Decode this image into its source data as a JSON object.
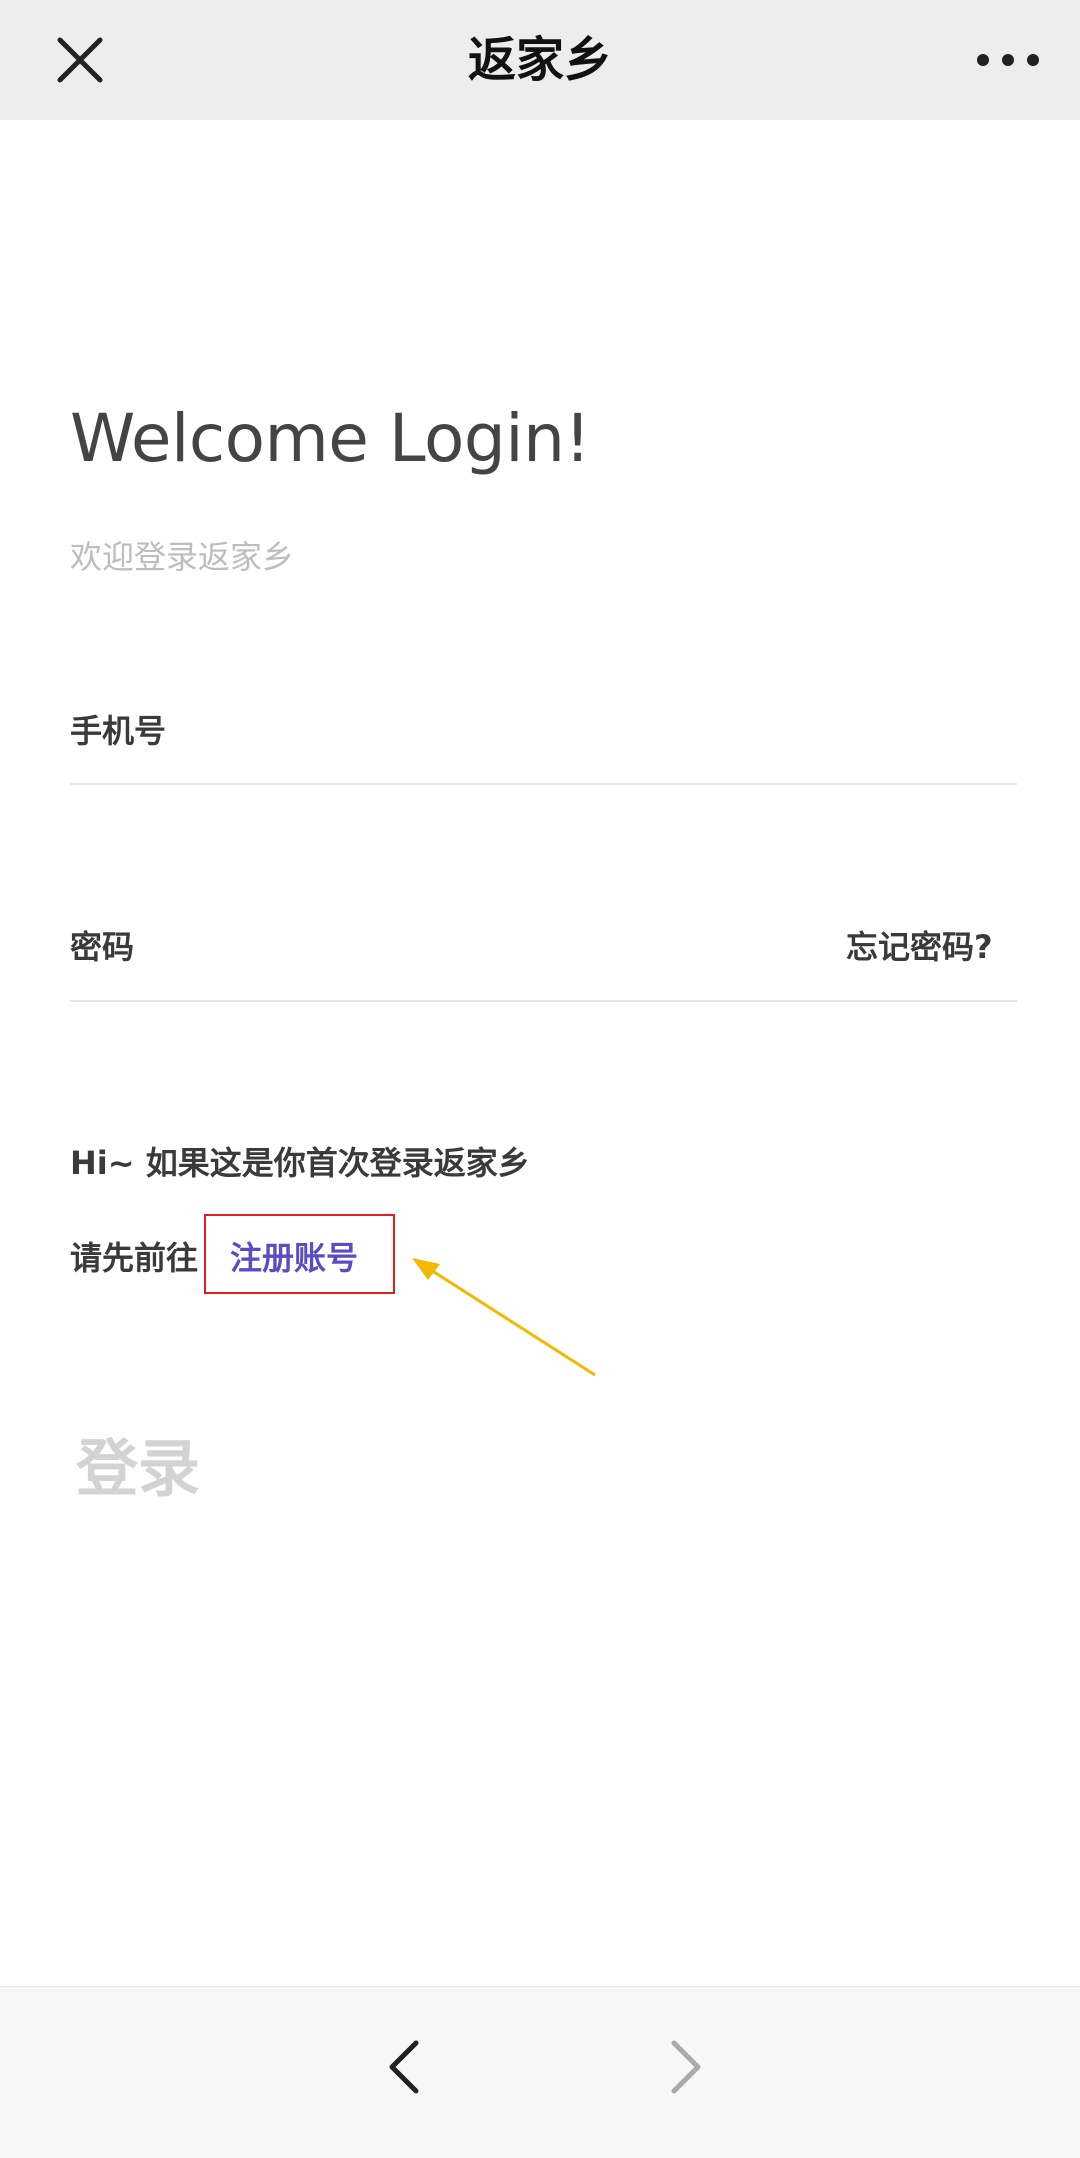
{
  "header": {
    "title": "返家乡",
    "close_icon": "close-icon",
    "more_icon": "more-horizontal-icon"
  },
  "main": {
    "welcome": "Welcome Login!",
    "subtitle": "欢迎登录返家乡",
    "phone_label": "手机号",
    "password_label": "密码",
    "forgot_password": "忘记密码?",
    "hint_line1": "Hi~ 如果这是你首次登录返家乡",
    "hint_line2_prefix": "请先前往",
    "register_link": "注册账号",
    "login_button": "登录"
  },
  "footer": {
    "back_icon": "chevron-left-icon",
    "forward_icon": "chevron-right-icon"
  },
  "colors": {
    "header_bg": "#ededed",
    "register_link": "#5b4cc4",
    "highlight_box": "#e02020",
    "annotation_arrow": "#f5b800",
    "disabled_text": "#d3d3d3"
  }
}
